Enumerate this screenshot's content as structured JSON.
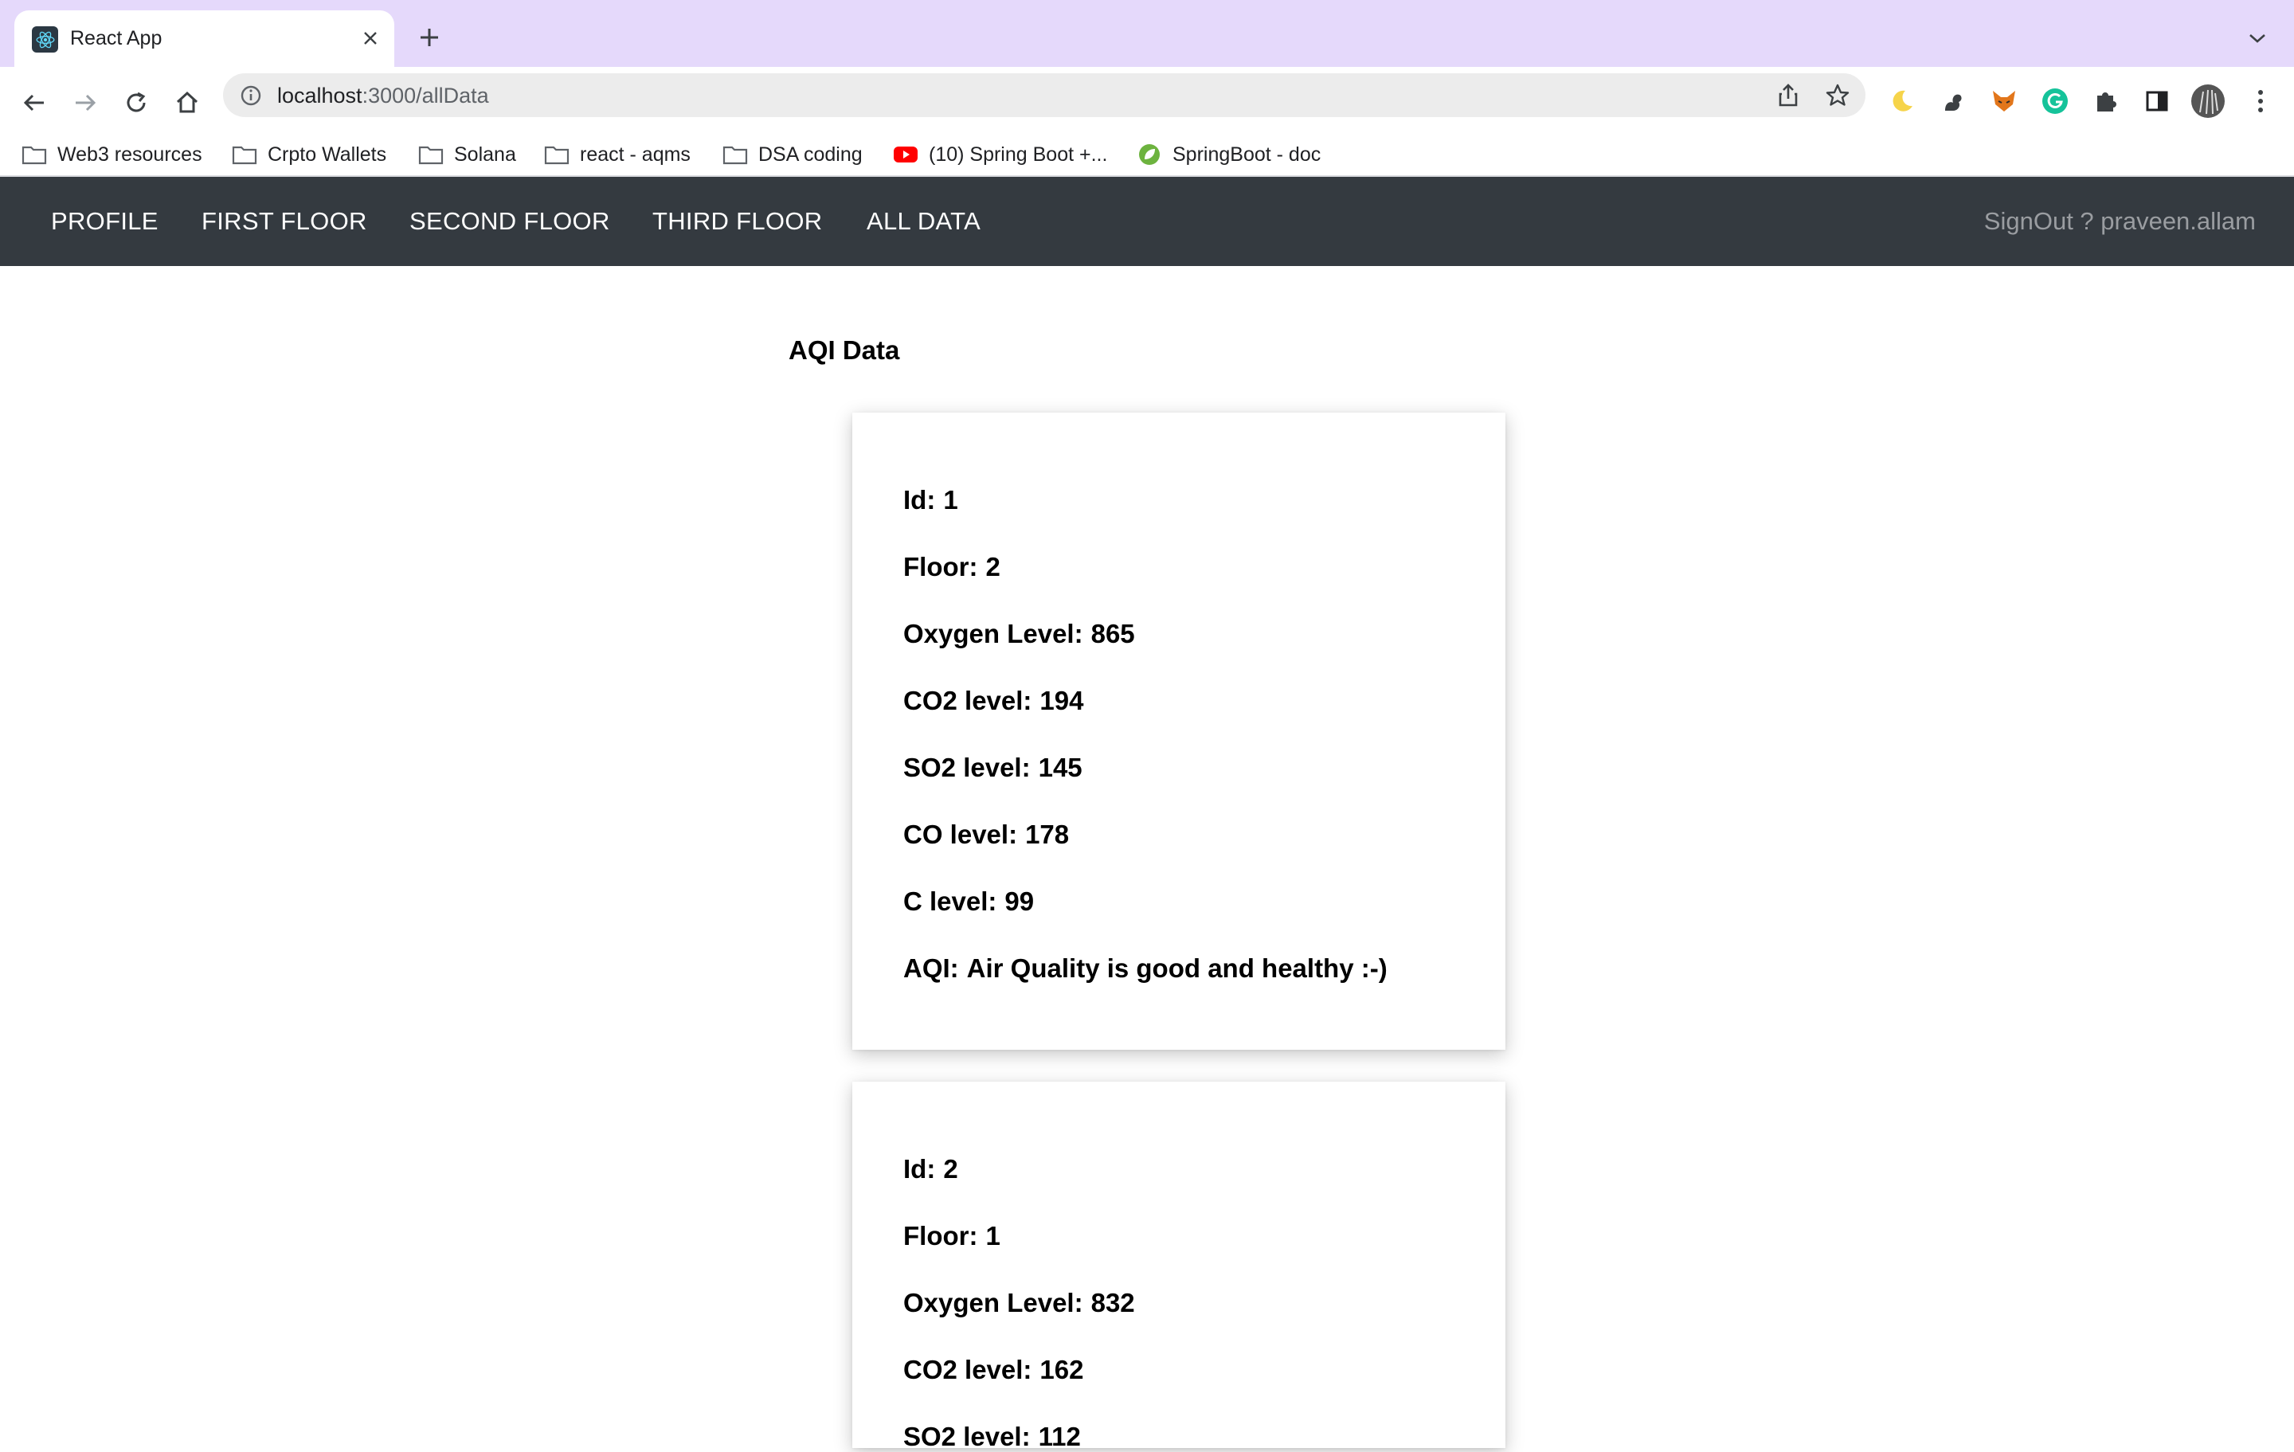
{
  "browser": {
    "tab_title": "React App",
    "url_host": "localhost",
    "url_path": ":3000/allData",
    "bookmarks": [
      {
        "label": "Web3 resources",
        "icon": "folder-icon"
      },
      {
        "label": "Crpto Wallets",
        "icon": "folder-icon"
      },
      {
        "label": "Solana",
        "icon": "folder-icon"
      },
      {
        "label": "react - aqms",
        "icon": "folder-icon"
      },
      {
        "label": "DSA coding",
        "icon": "folder-icon"
      },
      {
        "label": "(10) Spring Boot +...",
        "icon": "youtube-icon"
      },
      {
        "label": "SpringBoot - doc",
        "icon": "spring-leaf-icon"
      }
    ],
    "extensions": [
      "moon-icon",
      "squirrel-icon",
      "fox-icon",
      "grammarly-icon",
      "puzzle-icon",
      "sidebar-icon",
      "profile-avatar"
    ]
  },
  "navbar": {
    "links": [
      "PROFILE",
      "FIRST FLOOR",
      "SECOND FLOOR",
      "THIRD FLOOR",
      "ALL DATA"
    ],
    "signout": "SignOut ? praveen.allam"
  },
  "main": {
    "heading": "AQI Data",
    "records": [
      {
        "id_label": "Id:",
        "id": "1",
        "floor_label": "Floor:",
        "floor": "2",
        "oxygen_label": "Oxygen Level:",
        "oxygen": "865",
        "co2_label": "CO2 level:",
        "co2": "194",
        "so2_label": "SO2 level:",
        "so2": "145",
        "co_label": "CO level:",
        "co": "178",
        "c_label": "C level:",
        "c": "99",
        "aqi_label": "AQI:",
        "aqi": "Air Quality is good and healthy :-)"
      },
      {
        "id_label": "Id:",
        "id": "2",
        "floor_label": "Floor:",
        "floor": "1",
        "oxygen_label": "Oxygen Level:",
        "oxygen": "832",
        "co2_label": "CO2 level:",
        "co2": "162",
        "so2_label": "SO2 level:",
        "so2": "112"
      }
    ]
  },
  "colors": {
    "tabstrip": "#e5d9fb",
    "navbar": "#343a40",
    "signout": "#9a9da1"
  }
}
